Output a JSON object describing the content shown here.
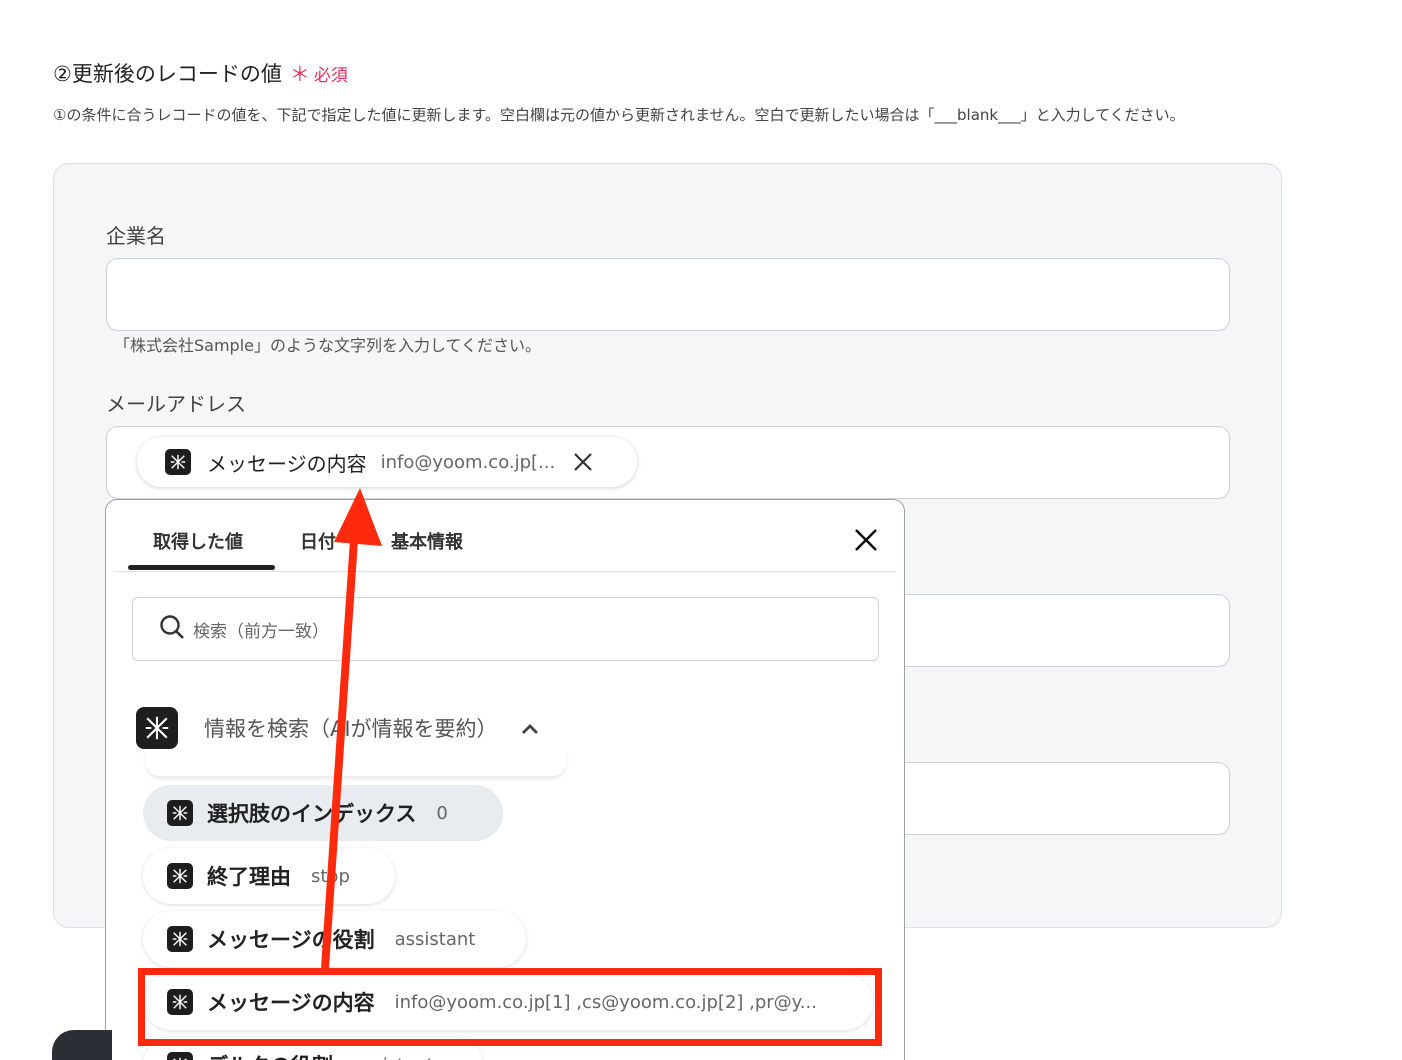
{
  "section": {
    "title": "②更新後のレコードの値",
    "required_mark": "＊",
    "required_label": "必須",
    "description": "①の条件に合うレコードの値を、下記で指定した値に更新します。空白欄は元の値から更新されません。空白で更新したい場合は「___blank___」と入力してください。"
  },
  "fields": {
    "company": {
      "label": "企業名",
      "hint": "「株式会社Sample」のような文字列を入力してください。"
    },
    "email": {
      "label": "メールアドレス",
      "chip": {
        "name": "メッセージの内容",
        "value": "info@yoom.co.jp[..."
      }
    }
  },
  "dropdown": {
    "tabs": [
      "取得した値",
      "日付",
      "基本情報"
    ],
    "active_tab": "取得した値",
    "search_placeholder": "検索（前方一致）",
    "group_title": "情報を検索（AIが情報を要約）",
    "items": [
      {
        "name": "選択肢のインデックス",
        "value": "0",
        "selected": true
      },
      {
        "name": "終了理由",
        "value": "stop"
      },
      {
        "name": "メッセージの役割",
        "value": "assistant"
      },
      {
        "name": "メッセージの内容",
        "value": "info@yoom.co.jp[1] ,cs@yoom.co.jp[2] ,pr@y...",
        "highlighted": true
      },
      {
        "name": "デルタの役割",
        "value": "assistant"
      }
    ]
  },
  "colors": {
    "accent_required": "#e5325d",
    "annotation_red": "#ff2a0e",
    "icon_dark": "#1e1e1e"
  },
  "icons": [
    "yoom-app-icon",
    "close-icon",
    "search-icon",
    "chevron-up-icon"
  ]
}
